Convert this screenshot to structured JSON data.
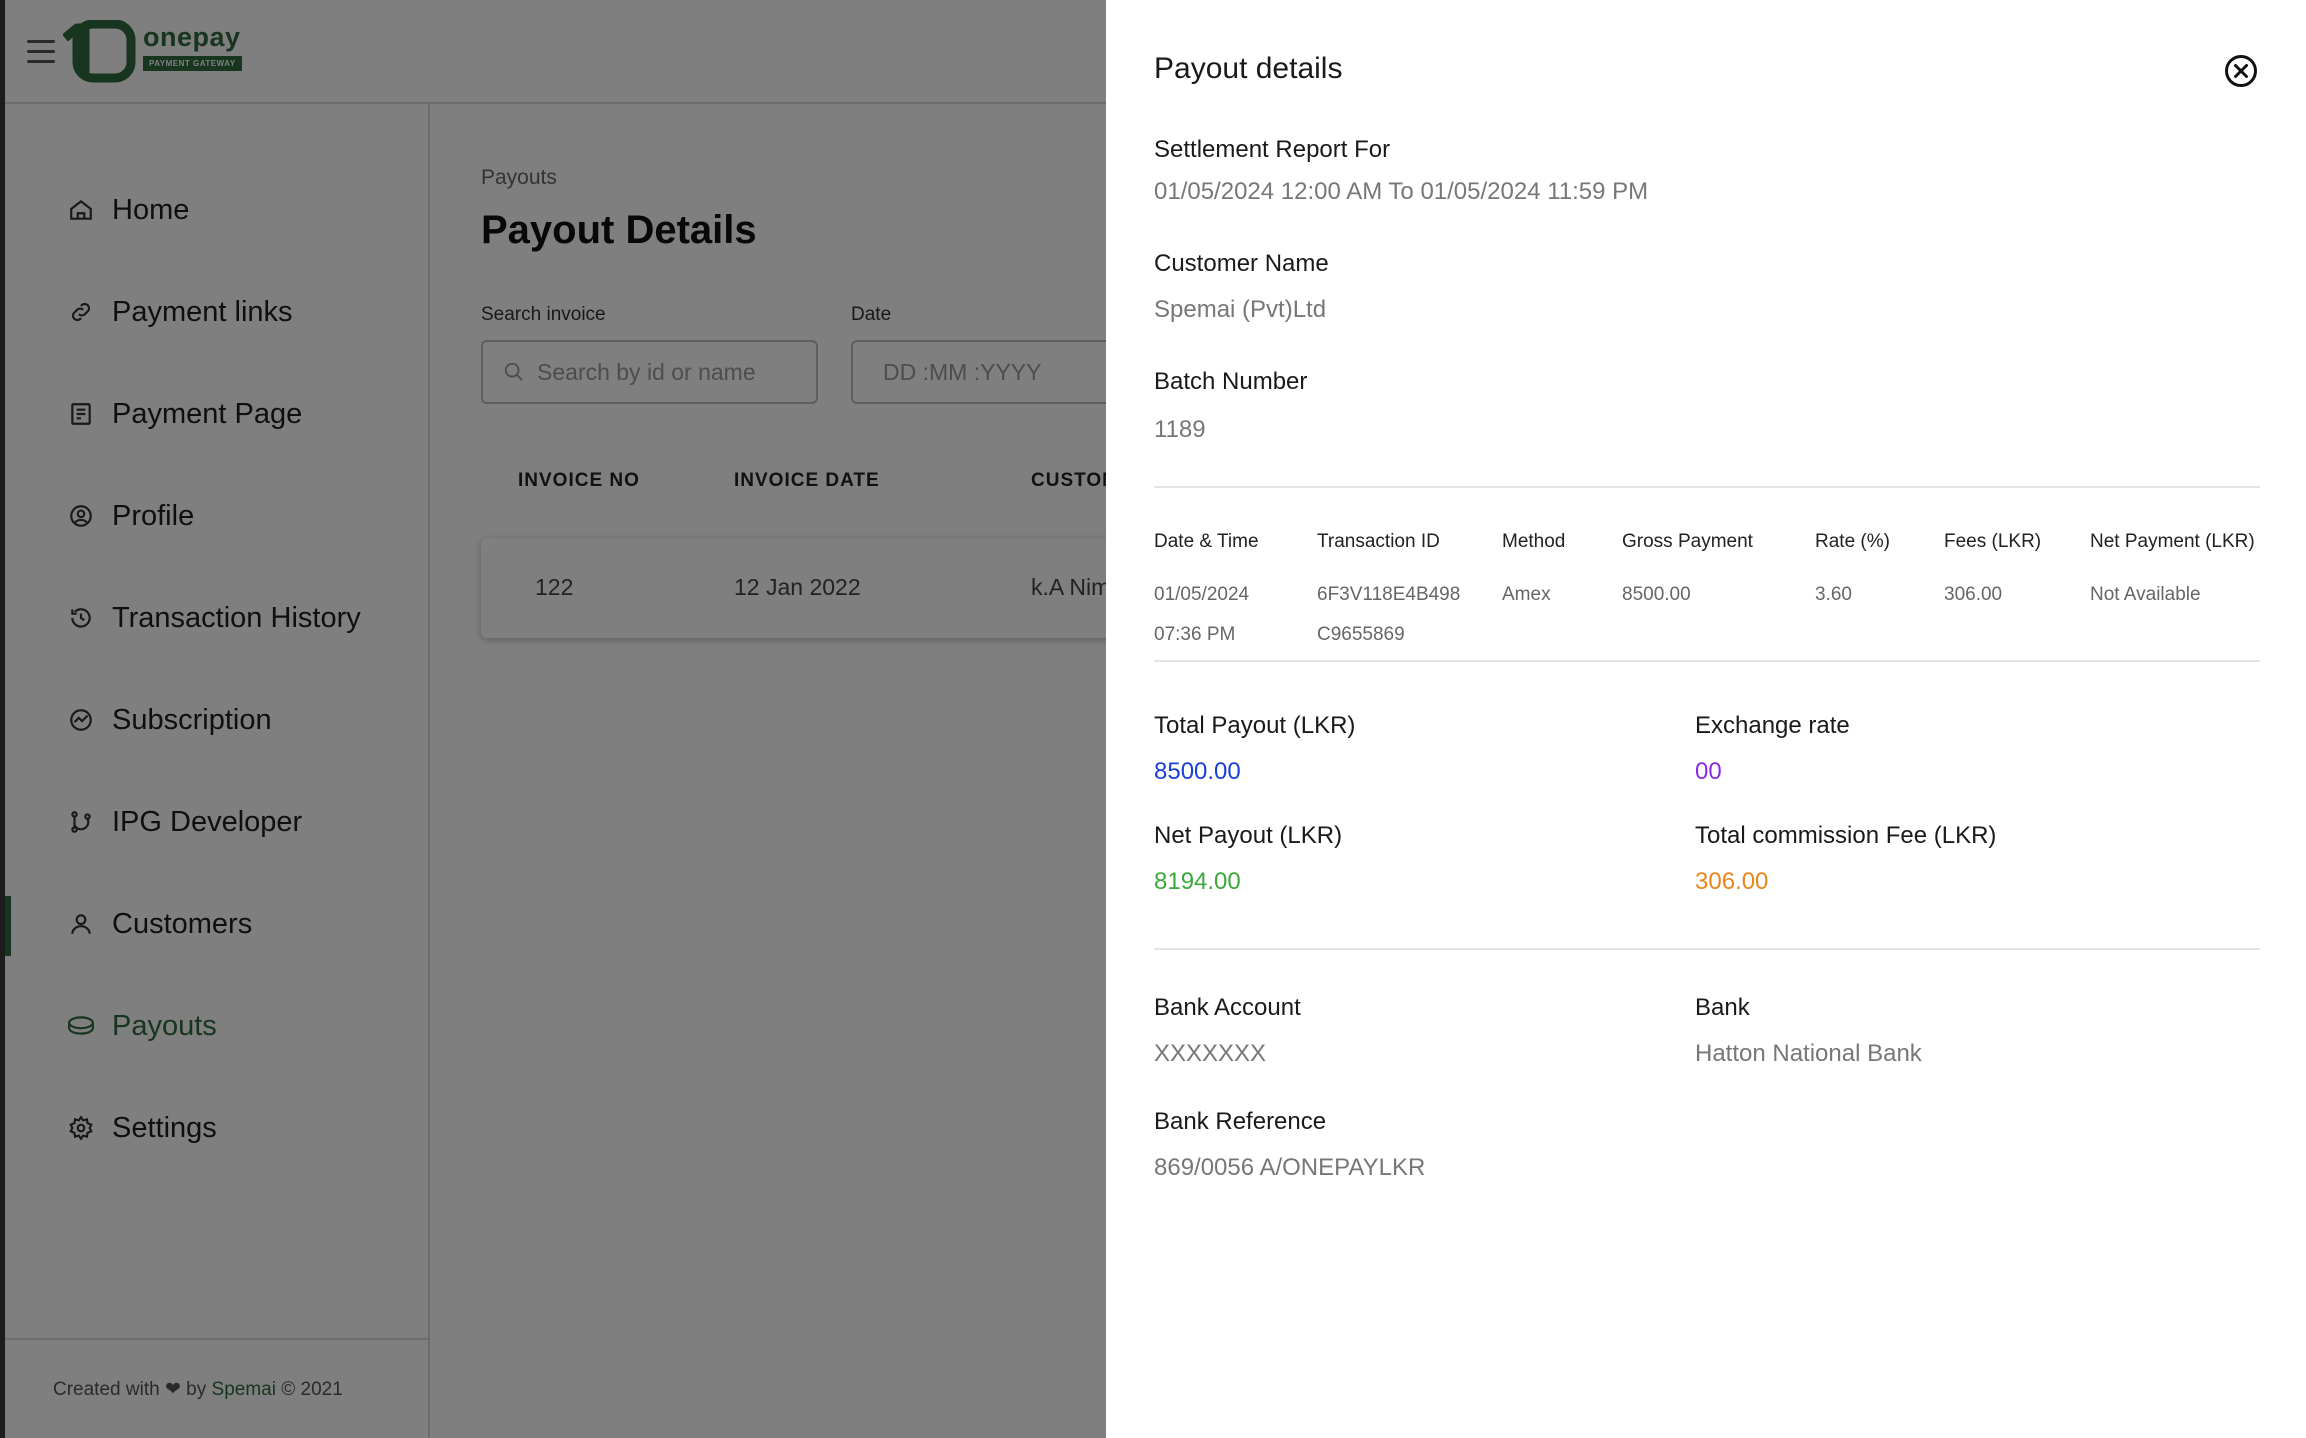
{
  "app": {
    "logo_text": "onepay",
    "logo_tagline": "PAYMENT GATEWAY"
  },
  "sidebar": {
    "items": [
      {
        "label": "Home",
        "icon": "home-icon"
      },
      {
        "label": "Payment links",
        "icon": "link-icon"
      },
      {
        "label": "Payment Page",
        "icon": "page-icon"
      },
      {
        "label": "Profile",
        "icon": "profile-icon"
      },
      {
        "label": "Transaction History",
        "icon": "history-icon"
      },
      {
        "label": "Subscription",
        "icon": "subscription-icon"
      },
      {
        "label": "IPG Developer",
        "icon": "branch-icon"
      },
      {
        "label": "Customers",
        "icon": "user-icon"
      },
      {
        "label": "Payouts",
        "icon": "coins-icon",
        "active": true
      },
      {
        "label": "Settings",
        "icon": "gear-icon"
      }
    ],
    "footer": {
      "prefix": "Created with",
      "by": "by",
      "brand": "Spemai",
      "suffix": "© 2021"
    }
  },
  "main": {
    "breadcrumb": "Payouts",
    "title": "Payout Details",
    "search_label": "Search invoice",
    "search_placeholder": "Search by id or name",
    "date_label": "Date",
    "date_placeholder": "DD :MM :YYYY",
    "table": {
      "headers": [
        "INVOICE NO",
        "INVOICE DATE",
        "CUSTOM"
      ],
      "row": [
        "122",
        "12 Jan 2022",
        "k.A Nim"
      ]
    }
  },
  "drawer": {
    "title": "Payout details",
    "settlement_label": "Settlement Report For",
    "settlement_value": "01/05/2024 12:00 AM To 01/05/2024 11:59 PM",
    "customer_label": "Customer Name",
    "customer_value": "Spemai (Pvt)Ltd",
    "batch_label": "Batch Number",
    "batch_value": "1189",
    "transactions": {
      "headers": [
        "Date & Time",
        "Transaction ID",
        "Method",
        "Gross Payment",
        "Rate (%)",
        "Fees (LKR)",
        "Net Payment (LKR)"
      ],
      "row": {
        "date": "01/05/2024",
        "time": "07:36 PM",
        "id_line1": "6F3V118E4B498",
        "id_line2": "C9655869",
        "method": "Amex",
        "gross": "8500.00",
        "rate": "3.60",
        "fees": "306.00",
        "net": "Not Available"
      }
    },
    "summary": {
      "total_payout_label": "Total Payout (LKR)",
      "total_payout_value": "8500.00",
      "exchange_rate_label": "Exchange rate",
      "exchange_rate_value": "00",
      "net_payout_label": "Net Payout (LKR)",
      "net_payout_value": "8194.00",
      "commission_label": "Total commission Fee (LKR)",
      "commission_value": "306.00"
    },
    "bank": {
      "account_label": "Bank Account",
      "account_value": "XXXXXXX",
      "bank_label": "Bank",
      "bank_value": "Hatton National Bank",
      "reference_label": "Bank Reference",
      "reference_value": "869/0056 A/ONEPAYLKR"
    }
  },
  "colors": {
    "brand_green": "#2e6b3e",
    "total_payout": "#1a3fd6",
    "exchange_rate": "#8a2be2",
    "net_payout": "#3aa83a",
    "commission": "#e8861a",
    "overlay": "rgba(0,0,0,0.5)"
  }
}
